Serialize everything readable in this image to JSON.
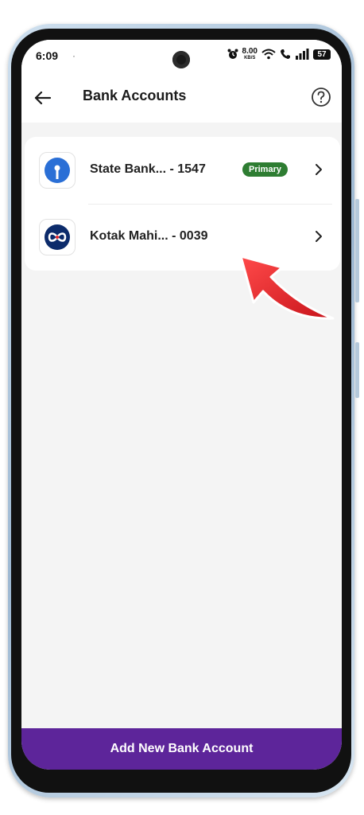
{
  "status_bar": {
    "time": "6:09",
    "dot": "·",
    "net_speed_value": "8.00",
    "net_speed_unit": "KB/S",
    "battery": "57",
    "icons": [
      "alarm-icon",
      "wifi-icon",
      "call-icon",
      "signal-icon",
      "battery-icon"
    ]
  },
  "header": {
    "title": "Bank Accounts",
    "back_icon": "arrow-left-icon",
    "help_icon": "question-circle-icon"
  },
  "accounts": [
    {
      "name": "State Bank... - 1547",
      "badge": "Primary",
      "logo": "sbi-logo",
      "logo_color": "#2a6fd6"
    },
    {
      "name": "Kotak Mahi... - 0039",
      "badge": "",
      "logo": "kotak-logo",
      "logo_color": "#0c2b6b"
    }
  ],
  "footer": {
    "add_label": "Add New Bank Account",
    "button_color": "#5d259a"
  },
  "colors": {
    "badge": "#2e7d32",
    "arrow": "#e8242b"
  }
}
